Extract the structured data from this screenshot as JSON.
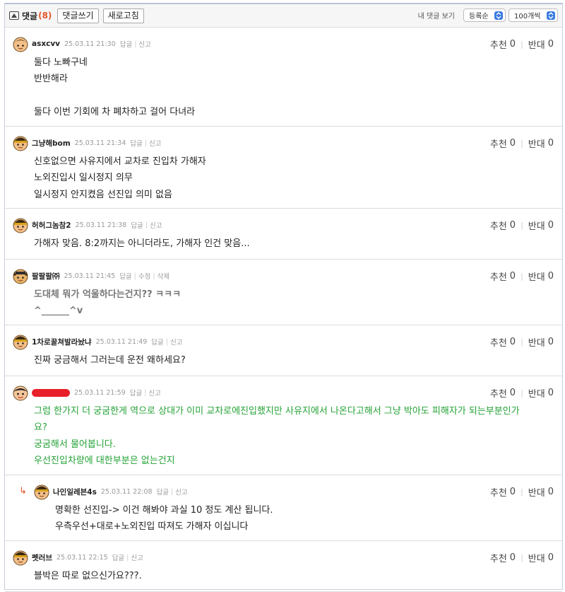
{
  "header": {
    "title": "댓글",
    "count": "(8)",
    "write_button": "댓글쓰기",
    "refresh_button": "새로고침",
    "my_comments_link": "내 댓글 보기",
    "sort_select": "등록순",
    "per_page_select": "100개씩"
  },
  "vote_labels": {
    "up": "추천",
    "down": "반대"
  },
  "comments": [
    {
      "nickname": "asxcvv",
      "date": "25.03.11 21:30",
      "actions": [
        "답글",
        "신고"
      ],
      "up": "0",
      "down": "0",
      "lines": [
        "둘다 노빠구네",
        "반반해라",
        "",
        "둘다 이번 기회에 차 폐차하고 걸어 다녀라"
      ]
    },
    {
      "nickname": "그냥해bom",
      "date": "25.03.11 21:34",
      "actions": [
        "답글",
        "신고"
      ],
      "up": "0",
      "down": "0",
      "lines": [
        "신호없으면 사유지에서 교차로 진입차 가해자",
        "노외진입시 일시정지 의무",
        "일시정지 안지켰음 선진입 의미 없음"
      ]
    },
    {
      "nickname": "허허그놈참2",
      "date": "25.03.11 21:38",
      "actions": [
        "답글",
        "신고"
      ],
      "up": "0",
      "down": "0",
      "lines": [
        "가해자 맞음. 8:2까지는 아니더라도, 가해자 인건 맞음..."
      ]
    },
    {
      "nickname": "팔팔팔㈜",
      "date": "25.03.11 21:45",
      "actions": [
        "답글",
        "수정",
        "삭제"
      ],
      "up": "0",
      "down": "0",
      "lines": [
        "도대체 뭐가 억울하다는건지?? ㅋㅋㅋ",
        "^______^v"
      ]
    },
    {
      "nickname": "1차로꿀쳐발라놨냐",
      "date": "25.03.11 21:49",
      "actions": [
        "답글",
        "신고"
      ],
      "up": "0",
      "down": "0",
      "lines": [
        "진짜 궁금해서 그러는데 운전 왜하세요?"
      ]
    },
    {
      "nickname": "",
      "date": "25.03.11 21:59",
      "actions": [
        "답글",
        "신고"
      ],
      "up": "0",
      "down": "0",
      "lines": [
        "그럼 한가지 더 궁굼한게 역으로 상대가 이미 교차로에진입했지만 사유지에서 나온다고해서 그냥 박아도 피해자가 되는부분인가",
        "요?",
        "궁굼해서 물어봅니다.",
        "우선진입차량에 대한부분은 없는건지"
      ]
    },
    {
      "nickname": "나인일레븐4s",
      "date": "25.03.11 22:08",
      "actions": [
        "답글",
        "신고"
      ],
      "up": "0",
      "down": "0",
      "reply_arrow": "↳",
      "lines": [
        "명확한 선진입-> 이건 해봐야 과실 10 정도 계산 됩니다.",
        "우측우선+대로+노외진입 따져도 가해자 이십니다"
      ]
    },
    {
      "nickname": "펫러브",
      "date": "25.03.11 22:15",
      "actions": [
        "답글",
        "신고"
      ],
      "up": "0",
      "down": "0",
      "lines": [
        "블박은 따로 없으신가요???."
      ]
    }
  ],
  "colors": {
    "accent_count": "#e2572c",
    "green_text": "#24a236",
    "redaction": "#e8202a",
    "select_arrow": "#3a7ae0"
  }
}
